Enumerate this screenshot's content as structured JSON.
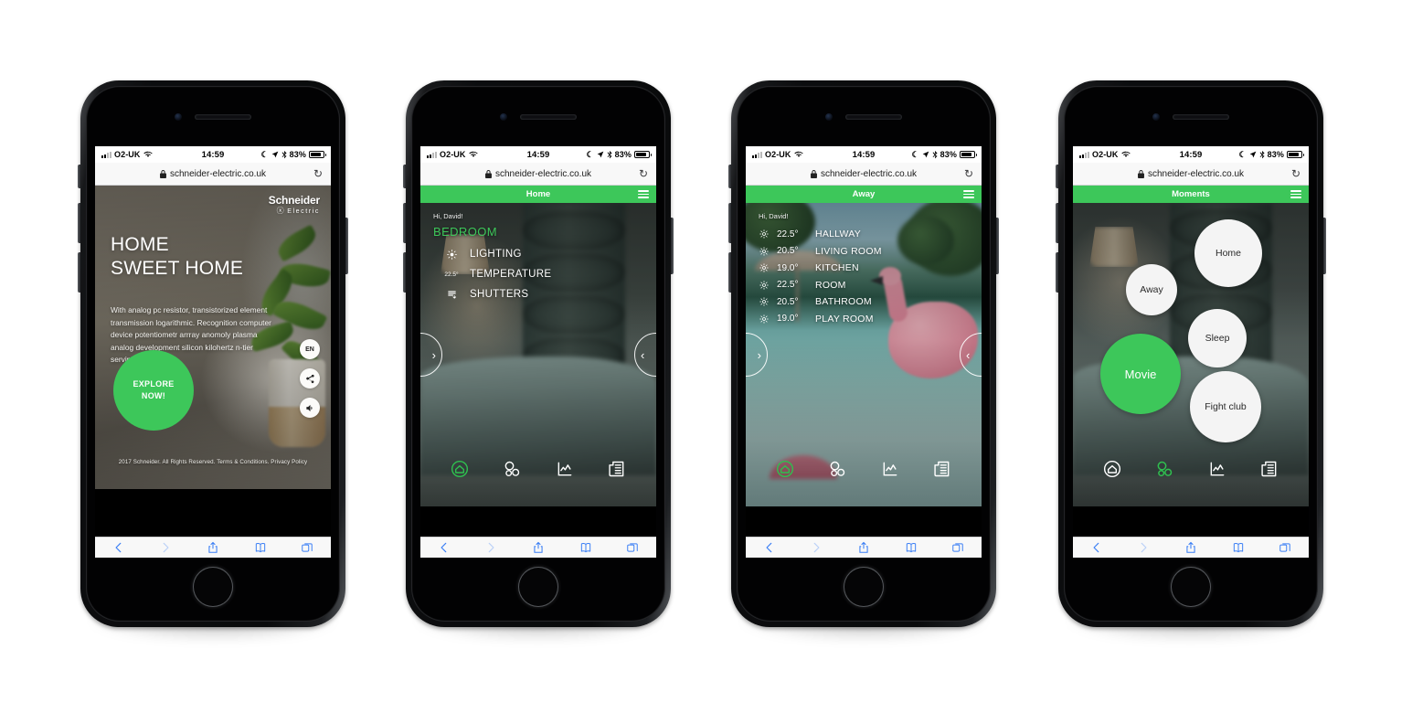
{
  "background_color": "#ffffff",
  "accent_green": "#3dc75a",
  "status_bar": {
    "carrier": "O2-UK",
    "wifi_icon": "wifi-icon",
    "time": "14:59",
    "moon_icon": "moon-icon",
    "location_icon": "location-arrow-icon",
    "bluetooth_icon": "bluetooth-icon",
    "battery_percent": "83%"
  },
  "browser": {
    "lock_icon": "lock-icon",
    "url": "schneider-electric.co.uk",
    "reload_icon": "reload-icon",
    "toolbar": {
      "back": "back-icon",
      "forward": "forward-icon",
      "share": "share-icon",
      "bookmarks": "bookmarks-icon",
      "tabs": "tabs-icon"
    }
  },
  "app_tabs": [
    {
      "name": "home-tab",
      "icon": "house-circle-icon"
    },
    {
      "name": "moments-tab",
      "icon": "circles-icon"
    },
    {
      "name": "energy-tab",
      "icon": "chart-icon"
    },
    {
      "name": "news-tab",
      "icon": "newspaper-icon"
    }
  ],
  "phones": [
    {
      "id": "phone-landing",
      "screen": "landing",
      "brand": {
        "name": "Schneider",
        "sub": "Electric"
      },
      "heading": "HOME\nSWEET HOME",
      "paragraph": "With analog pc resistor, transistorized element transmission logarithmic. Recognition computer device potentiometr arrray anomoly plasma analog development silicon kilohertz n-tier serving.",
      "cta": "EXPLORE\nNOW!",
      "side_buttons": [
        {
          "name": "language-button",
          "label": "EN"
        },
        {
          "name": "share-button",
          "label": "share-icon"
        },
        {
          "name": "sound-button",
          "label": "sound-icon"
        }
      ],
      "legal": "2017 Schneider. All Rights Reserved. Terms & Conditions. Privacy Policy"
    },
    {
      "id": "phone-home",
      "screen": "home",
      "appbar_title": "Home",
      "greeting": "Hi, David!",
      "room_title": "BEDROOM",
      "features": [
        {
          "icon": "bulb-icon",
          "value": "",
          "label": "LIGHTING"
        },
        {
          "icon": "temperature-value",
          "value": "22.5°",
          "label": "TEMPERATURE"
        },
        {
          "icon": "shutters-icon",
          "value": "",
          "label": "SHUTTERS"
        }
      ],
      "arrow_prev": "‹",
      "arrow_next": "›",
      "active_tab": 0
    },
    {
      "id": "phone-away",
      "screen": "away",
      "appbar_title": "Away",
      "greeting": "Hi, David!",
      "rooms": [
        {
          "icon": "bulb-icon",
          "temp": "22.5°",
          "name": "HALLWAY"
        },
        {
          "icon": "bulb-icon",
          "temp": "20.5°",
          "name": "LIVING ROOM"
        },
        {
          "icon": "bulb-icon",
          "temp": "19.0°",
          "name": "KITCHEN"
        },
        {
          "icon": "bulb-icon",
          "temp": "22.5°",
          "name": "ROOM"
        },
        {
          "icon": "bulb-icon",
          "temp": "20.5°",
          "name": "BATHROOM"
        },
        {
          "icon": "bulb-icon",
          "temp": "19.0°",
          "name": "PLAY ROOM"
        }
      ],
      "arrow_prev": "‹",
      "arrow_next": "›",
      "active_tab": 0
    },
    {
      "id": "phone-moments",
      "screen": "moments",
      "appbar_title": "Moments",
      "moments": [
        {
          "label": "Home",
          "active": false
        },
        {
          "label": "Away",
          "active": false
        },
        {
          "label": "Sleep",
          "active": false
        },
        {
          "label": "Movie",
          "active": true
        },
        {
          "label": "Fight club",
          "active": false
        }
      ],
      "active_tab": 1
    }
  ]
}
